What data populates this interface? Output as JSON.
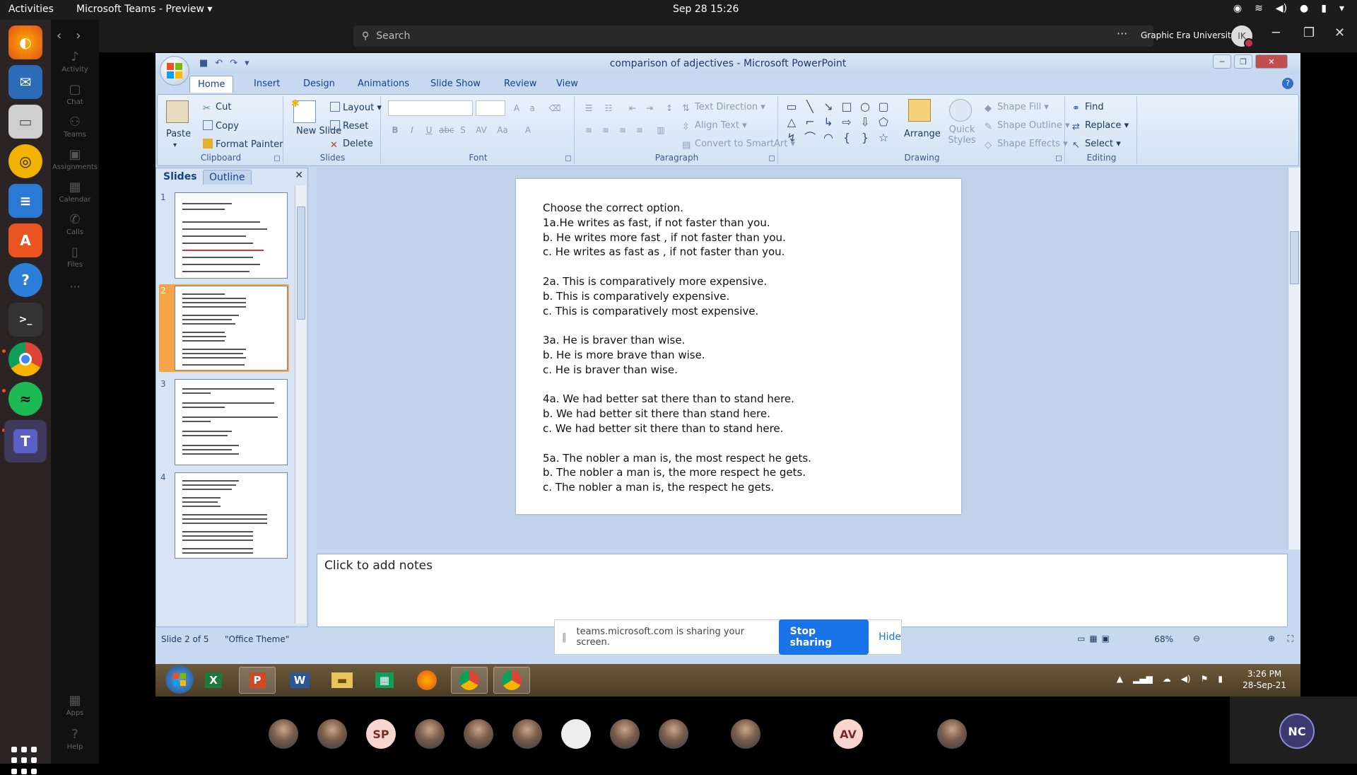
{
  "topbar": {
    "activities": "Activities",
    "app": "Microsoft Teams - Preview ▾",
    "clock": "Sep 28  15:26"
  },
  "teams": {
    "search_placeholder": "Search",
    "org": "Graphic Era University",
    "avatar": "IK",
    "rail": [
      "Activity",
      "Chat",
      "Teams",
      "Assignments",
      "Calendar",
      "Calls",
      "Files",
      "Apps",
      "Help"
    ]
  },
  "ppt": {
    "title": "comparison of adjectives - Microsoft PowerPoint",
    "tabs": [
      "Home",
      "Insert",
      "Design",
      "Animations",
      "Slide Show",
      "Review",
      "View"
    ],
    "clipboard": {
      "paste": "Paste",
      "cut": "Cut",
      "copy": "Copy",
      "format_painter": "Format Painter",
      "label": "Clipboard"
    },
    "slides_group": {
      "new_slide": "New Slide",
      "layout": "Layout",
      "reset": "Reset",
      "delete": "Delete",
      "label": "Slides"
    },
    "font_group": {
      "label": "Font"
    },
    "paragraph": {
      "text_direction": "Text Direction",
      "align_text": "Align Text",
      "convert": "Convert to SmartArt",
      "label": "Paragraph"
    },
    "drawing": {
      "arrange": "Arrange",
      "quick_styles": "Quick Styles",
      "shape_fill": "Shape Fill",
      "shape_outline": "Shape Outline",
      "shape_effects": "Shape Effects",
      "label": "Drawing"
    },
    "editing": {
      "find": "Find",
      "replace": "Replace",
      "select": "Select",
      "label": "Editing"
    },
    "pane_tabs": {
      "slides": "Slides",
      "outline": "Outline"
    },
    "slide_lines": [
      "Choose the correct option.",
      "1a.He writes as fast, if not faster than you.",
      "b. He writes more fast , if not faster than you.",
      "c. He writes as fast as , if not faster than you.",
      "",
      "2a. This is comparatively more expensive.",
      "b. This is comparatively expensive.",
      "c. This is comparatively most expensive.",
      "",
      "3a. He is braver than wise.",
      "b. He is more brave than wise.",
      "c. He is braver than wise.",
      "",
      "4a. We had better sat there than to stand here.",
      "b. We had better sit there than stand here.",
      "c. We had better sit there than to stand here.",
      "",
      "5a. The nobler a man is, the most respect he gets.",
      "b. The nobler a man is, the more respect he gets.",
      "c. The nobler a man is, the respect he gets."
    ],
    "notes_placeholder": "Click to add notes",
    "status_slide": "Slide 2 of 5",
    "status_theme": "\"Office Theme\"",
    "zoom": "68%"
  },
  "share_banner": {
    "text": "teams.microsoft.com is sharing your screen.",
    "stop": "Stop sharing",
    "hide": "Hide"
  },
  "win_taskbar": {
    "time": "3:26 PM",
    "date": "28-Sep-21"
  },
  "participants": [
    "SP",
    "AV",
    "NC"
  ]
}
